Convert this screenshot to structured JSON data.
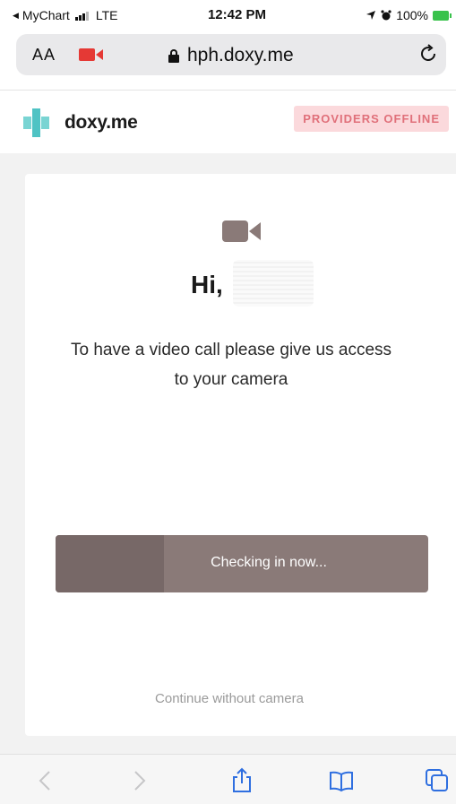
{
  "status_bar": {
    "back_app": "MyChart",
    "network": "LTE",
    "time": "12:42 PM",
    "battery": "100%"
  },
  "address_bar": {
    "text_size_label": "AA",
    "url": "hph.doxy.me"
  },
  "header": {
    "logo_text": "doxy.me",
    "status_badge": "PROVIDERS OFFLINE"
  },
  "main": {
    "greeting": "Hi,",
    "message_line1": "To have a video call please give us access",
    "message_line2": "to your camera",
    "checkin_label": "Checking in now...",
    "checkin_progress": 0.29,
    "continue_link": "Continue without camera"
  },
  "colors": {
    "badge_bg": "#fbd9dc",
    "badge_text": "#e0707a",
    "button_bg": "#8a7a78",
    "logo_teal": "#4fc3c4",
    "record_red": "#e53935",
    "toolbar_blue": "#2f6fe0"
  },
  "toolbar": {
    "icons": [
      "back-arrow-icon",
      "forward-arrow-icon",
      "share-icon",
      "bookmarks-icon",
      "tabs-icon"
    ]
  }
}
